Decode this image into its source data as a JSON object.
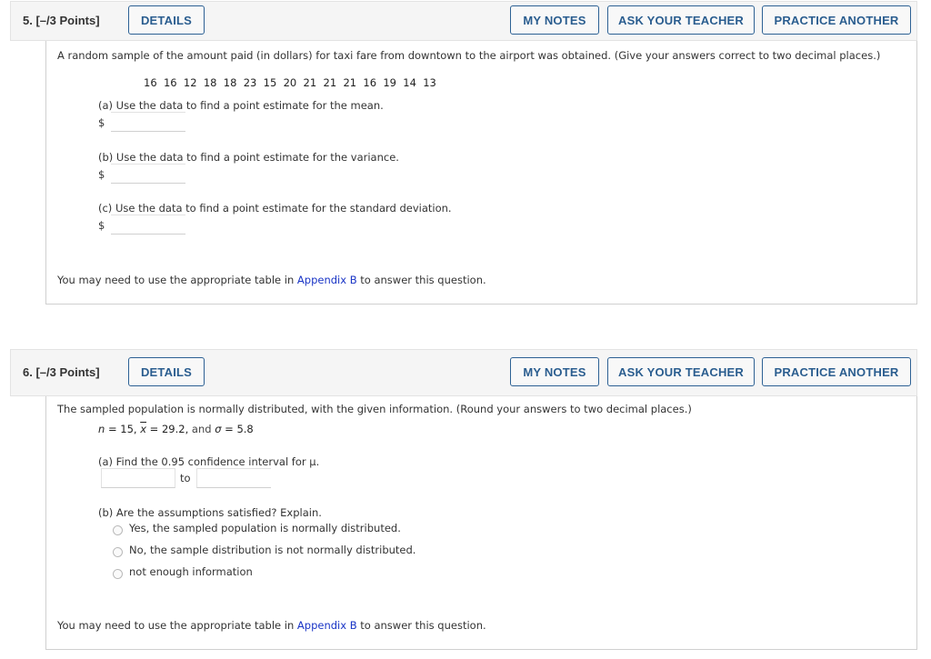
{
  "questions": [
    {
      "title": "5.  [–/3 Points]",
      "buttons": {
        "details": "DETAILS",
        "my_notes": "MY NOTES",
        "ask_teacher": "ASK YOUR TEACHER",
        "practice": "PRACTICE ANOTHER"
      },
      "prompt": "A random sample of the amount paid (in dollars) for taxi fare from downtown to the airport was obtained. (Give your answers correct to two decimal places.)",
      "data_values": "16  16  12  18  18  23  15  20  21  21  21  16  19  14  13",
      "parts": [
        {
          "label": "(a) Use the data to find a point estimate for the mean.",
          "currency": "$",
          "value": ""
        },
        {
          "label": "(b) Use the data to find a point estimate for the variance.",
          "currency": "$",
          "value": ""
        },
        {
          "label": "(c) Use the data to find a point estimate for the standard deviation.",
          "currency": "$",
          "value": ""
        }
      ],
      "footer": {
        "before": "You may need to use the appropriate table in ",
        "link": "Appendix B",
        "after": " to answer this question."
      }
    },
    {
      "title": "6.  [–/3 Points]",
      "buttons": {
        "details": "DETAILS",
        "my_notes": "MY NOTES",
        "ask_teacher": "ASK YOUR TEACHER",
        "practice": "PRACTICE ANOTHER"
      },
      "prompt": "The sampled population is normally distributed, with the given information. (Round your answers to two decimal places.)",
      "given": {
        "n_sym": "n",
        "n_val": "15",
        "xbar_sym": "x",
        "xbar_val": "29.2",
        "and": "and",
        "sigma_sym": "σ",
        "sigma_val": "5.8"
      },
      "part_a": {
        "label": "(a) Find the 0.95 confidence interval for μ.",
        "lower": "",
        "to": "to",
        "upper": ""
      },
      "part_b": {
        "label": "(b) Are the assumptions satisfied? Explain.",
        "options": [
          "Yes, the sampled population is normally distributed.",
          "No, the sample distribution is not normally distributed.",
          "not enough information"
        ]
      },
      "footer": {
        "before": "You may need to use the appropriate table in ",
        "link": "Appendix B",
        "after": " to answer this question."
      }
    }
  ]
}
